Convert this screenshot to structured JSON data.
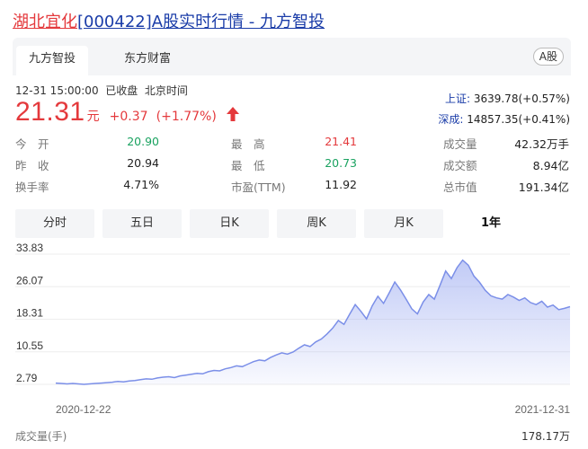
{
  "title": {
    "name": "湖北宜化",
    "code": "[000422]",
    "suffix": "A股实时行情 - 九方智投"
  },
  "tabs": {
    "items": [
      "九方智投",
      "东方财富"
    ],
    "badge": "A股"
  },
  "quote": {
    "datetime": "12-31 15:00:00",
    "status": "已收盘",
    "timezone": "北京时间",
    "price": "21.31",
    "unit": "元",
    "change": "+0.37",
    "change_pct": "(+1.77%)"
  },
  "indices": [
    {
      "label": "上证:",
      "value": "3639.78(+0.57%)"
    },
    {
      "label": "深成:",
      "value": "14857.35(+0.41%)"
    }
  ],
  "stats": {
    "open": {
      "label": "今　开",
      "value": "20.90"
    },
    "prev_close": {
      "label": "昨　收",
      "value": "20.94"
    },
    "turnover": {
      "label": "换手率",
      "value": "4.71%"
    },
    "high": {
      "label": "最　高",
      "value": "21.41"
    },
    "low": {
      "label": "最　低",
      "value": "20.73"
    },
    "pe": {
      "label": "市盈(TTM)",
      "value": "11.92"
    },
    "volume": {
      "label": "成交量",
      "value": "42.32万手"
    },
    "amount": {
      "label": "成交额",
      "value": "8.94亿"
    },
    "market_cap": {
      "label": "总市值",
      "value": "191.34亿"
    }
  },
  "periods": {
    "items": [
      "分时",
      "五日",
      "日K",
      "周K",
      "月K",
      "1年"
    ],
    "active": 5
  },
  "colors": {
    "up": "#e4393c",
    "down": "#1aa260",
    "link": "#1a3ca8",
    "line": "#7b8fe8"
  },
  "chart_data": {
    "type": "area",
    "y_ticks": [
      "33.83",
      "26.07",
      "18.31",
      "10.55",
      "2.79"
    ],
    "ylim": [
      2.79,
      33.83
    ],
    "x_ticks": [
      "2020-12-22",
      "2021-12-31"
    ],
    "series": [
      {
        "values": [
          3.1,
          3.0,
          2.9,
          3.0,
          2.9,
          2.8,
          2.9,
          3.0,
          3.1,
          3.2,
          3.3,
          3.5,
          3.4,
          3.6,
          3.7,
          3.9,
          4.1,
          4.0,
          4.3,
          4.5,
          4.6,
          4.4,
          4.8,
          5.0,
          5.2,
          5.4,
          5.3,
          5.8,
          6.1,
          6.0,
          6.5,
          6.8,
          7.2,
          7.0,
          7.6,
          8.2,
          8.6,
          8.4,
          9.2,
          9.8,
          10.3,
          10.0,
          10.5,
          11.4,
          12.2,
          11.8,
          12.9,
          13.6,
          14.8,
          16.2,
          18.0,
          17.1,
          19.5,
          21.8,
          20.2,
          18.4,
          21.5,
          23.8,
          22.1,
          24.6,
          27.2,
          25.3,
          23.1,
          20.8,
          19.6,
          22.4,
          24.2,
          23.1,
          26.4,
          29.8,
          28.0,
          30.6,
          32.4,
          31.2,
          28.6,
          27.1,
          25.2,
          23.9,
          23.4,
          23.1,
          24.2,
          23.6,
          22.8,
          23.4,
          22.3,
          21.8,
          22.6,
          21.2,
          21.7,
          20.6,
          20.9,
          21.31
        ]
      }
    ],
    "volume": {
      "label": "成交量(手)",
      "max_label": "178.17万"
    }
  }
}
